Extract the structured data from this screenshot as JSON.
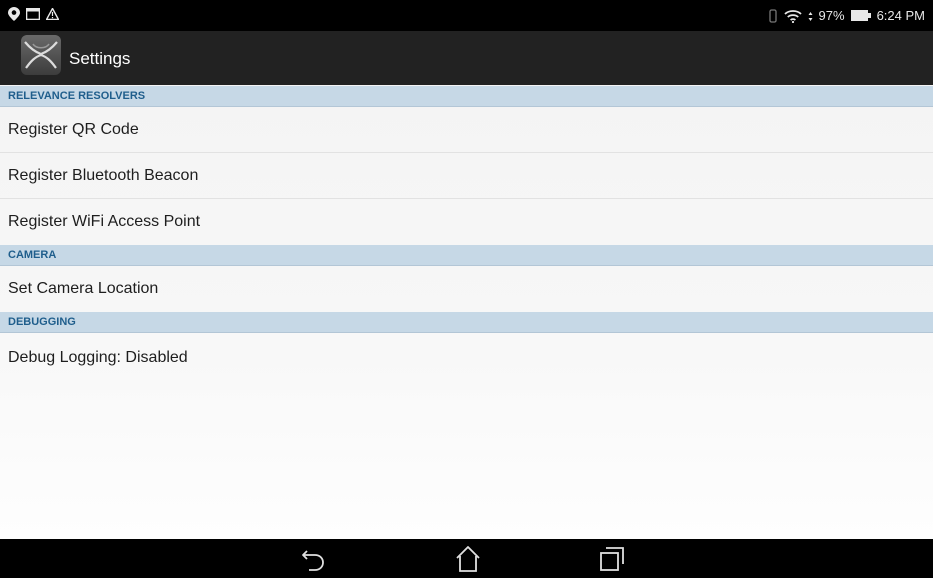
{
  "status_bar": {
    "left_icons": [
      "location-pin-icon",
      "image-icon",
      "warning-icon"
    ],
    "right_icons": [
      "vibrate-icon",
      "wifi-icon",
      "battery-icon"
    ],
    "battery_percent": "97%",
    "time": "6:24 PM"
  },
  "action_bar": {
    "title": "Settings",
    "icon": "app-logo-icon"
  },
  "sections": {
    "relevance_resolvers": {
      "header": "RELEVANCE RESOLVERS",
      "items": [
        "Register QR Code",
        "Register Bluetooth Beacon",
        "Register WiFi Access Point"
      ]
    },
    "camera": {
      "header": "CAMERA",
      "items": [
        "Set Camera Location"
      ]
    },
    "debugging": {
      "header": "DEBUGGING",
      "items": [
        "Debug Logging: Disabled"
      ]
    }
  },
  "nav_bar": {
    "buttons": [
      "back-icon",
      "home-icon",
      "recents-icon"
    ]
  },
  "colors": {
    "status_bar_bg": "#000000",
    "action_bar_bg": "#222222",
    "section_header_bg": "#c6d8e6",
    "section_header_text": "#1f5e8c",
    "nav_bar_bg": "#000000"
  }
}
